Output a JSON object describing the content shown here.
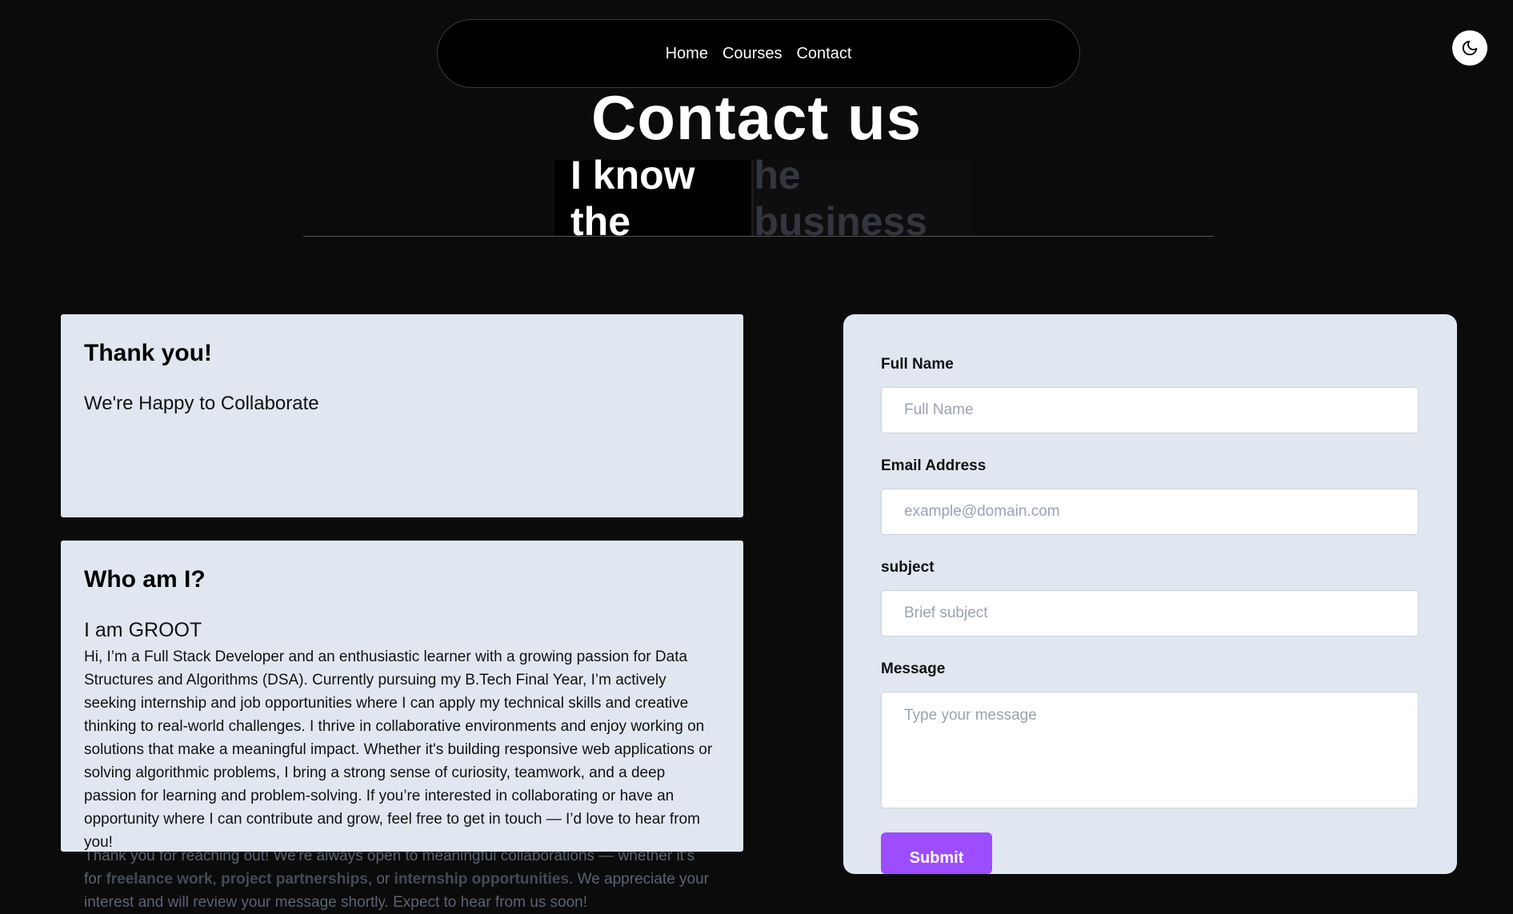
{
  "nav": {
    "items": [
      "Home",
      "Courses",
      "Contact"
    ]
  },
  "theme_toggle": {
    "icon": "moon-icon"
  },
  "hero": {
    "title": "Contact us",
    "typed_visible": "I know the",
    "typed_ghost": "he business"
  },
  "thanks_card": {
    "title": "Thank you!",
    "subtitle": "We're Happy to Collaborate",
    "text_1": "Thank you for reaching out! We're always open to meaningful collaborations — whether it's for ",
    "bold_1": "freelance work",
    "text_2": ", ",
    "bold_2": "project partnerships",
    "text_3": ", or ",
    "bold_3": "internship opportunities",
    "text_4": ". We appreciate your interest and will review your message shortly. Expect to hear from us soon!"
  },
  "about_card": {
    "title": "Who am I?",
    "subtitle": "I am GROOT",
    "text": "Hi, I’m a Full Stack Developer and an enthusiastic learner with a growing passion for Data Structures and Algorithms (DSA). Currently pursuing my B.Tech Final Year, I’m actively seeking internship and job opportunities where I can apply my technical skills and creative thinking to real-world challenges. I thrive in collaborative environments and enjoy working on solutions that make a meaningful impact. Whether it's building responsive web applications or solving algorithmic problems, I bring a strong sense of curiosity, teamwork, and a deep passion for learning and problem-solving. If you’re interested in collaborating or have an opportunity where I can contribute and grow, feel free to get in touch — I’d love to hear from you!"
  },
  "form": {
    "full_name": {
      "label": "Full Name",
      "placeholder": "Full Name",
      "value": ""
    },
    "email": {
      "label": "Email Address",
      "placeholder": "example@domain.com",
      "value": ""
    },
    "subject": {
      "label": "subject",
      "placeholder": "Brief subject",
      "value": ""
    },
    "message": {
      "label": "Message",
      "placeholder": "Type your message",
      "value": ""
    },
    "submit_label": "Submit"
  },
  "colors": {
    "background": "#0b0b0b",
    "card": "#e1e7f0",
    "accent": "#9b4dff"
  }
}
